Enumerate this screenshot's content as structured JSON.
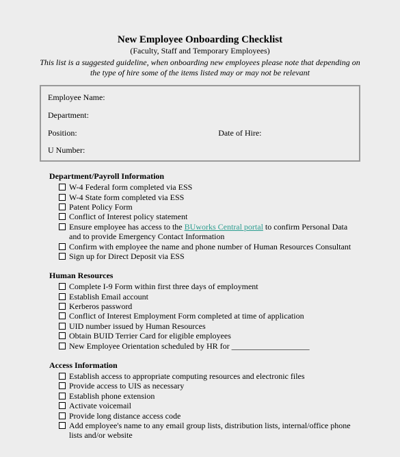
{
  "header": {
    "title": "New Employee Onboarding Checklist",
    "subtitle": "(Faculty, Staff and Temporary Employees)",
    "note": "This list is a suggested guideline, when onboarding new employees please note that depending on the type of hire some of the items listed may or may not be relevant"
  },
  "info": {
    "name_label": "Employee Name:",
    "dept_label": "Department:",
    "pos_label": "Position:",
    "doh_label": "Date of Hire:",
    "unum_label": "U Number:"
  },
  "sections": {
    "dept_payroll": {
      "title": "Department/Payroll Information",
      "i0": "W-4 Federal form completed via ESS",
      "i1": "W-4 State form completed via ESS",
      "i2": "Patent Policy Form",
      "i3": "Conflict of Interest policy statement",
      "i4a": "Ensure employee has access to the ",
      "i4_link": "BUworks Central portal",
      "i4b": " to confirm Personal Data and to provide Emergency Contact Information",
      "i5": "Confirm with employee the name and phone number of Human Resources Consultant",
      "i6": "Sign up for Direct Deposit via ESS"
    },
    "hr": {
      "title": "Human Resources",
      "i0": "Complete I-9 Form within first three days of employment",
      "i1": "Establish Email account",
      "i2": "Kerberos password",
      "i3": "Conflict of Interest Employment Form completed at time of application",
      "i4": "UID number issued by Human Resources",
      "i5": "Obtain BUID Terrier Card for eligible employees",
      "i6": "New Employee Orientation scheduled by HR for ___________________"
    },
    "access": {
      "title": "Access Information",
      "i0": "Establish access to appropriate computing resources and electronic files",
      "i1": "Provide access to UIS as necessary",
      "i2": "Establish phone extension",
      "i3": "Activate voicemail",
      "i4": "Provide long distance access code",
      "i5": "Add employee's name to any email group lists, distribution lists, internal/office phone lists and/or website"
    }
  }
}
